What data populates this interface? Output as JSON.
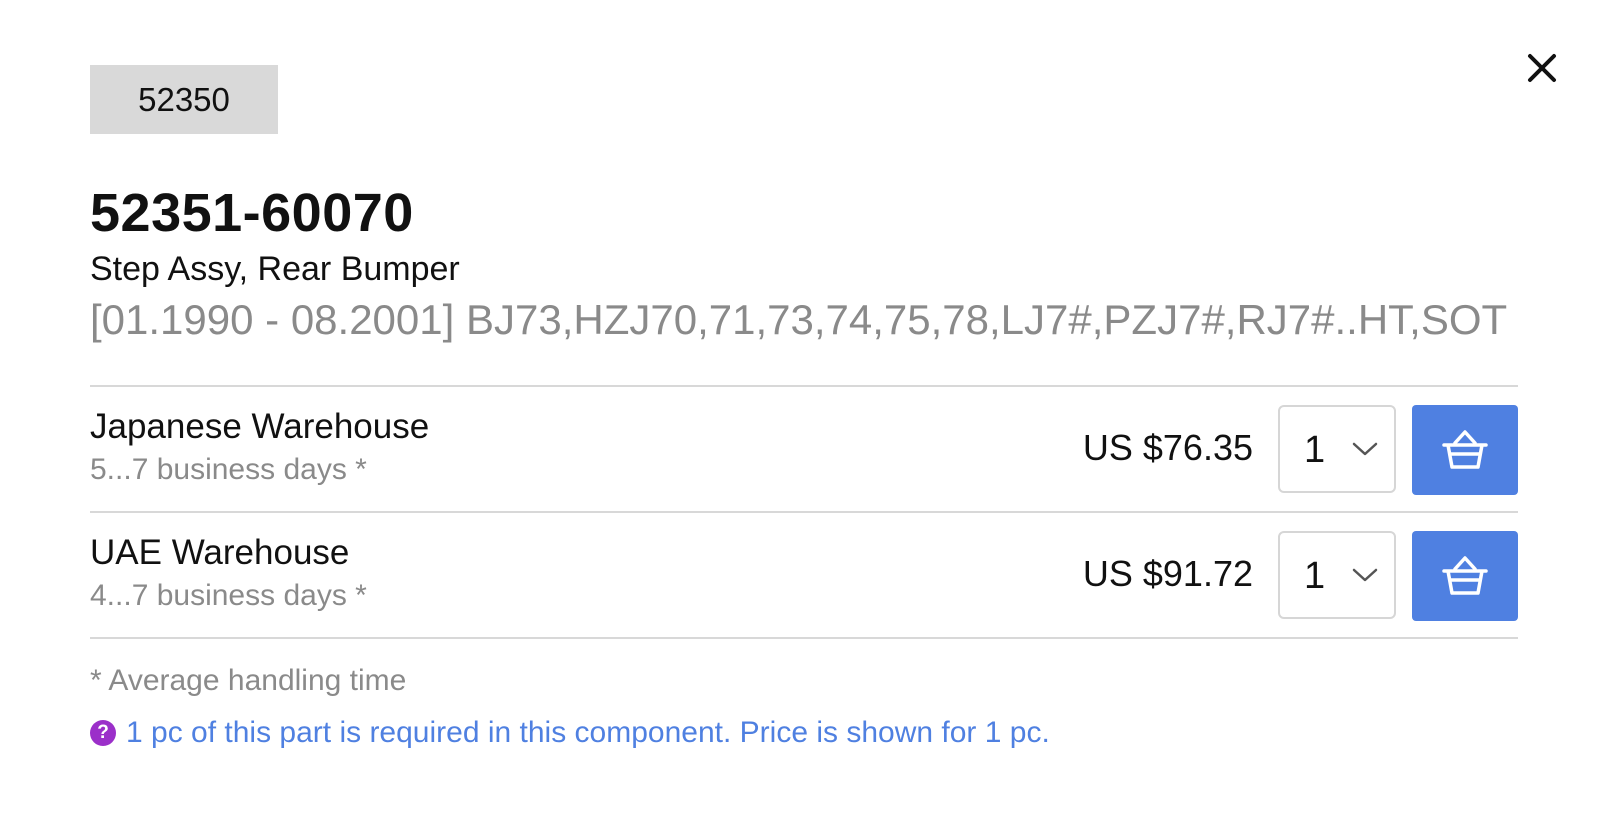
{
  "dialog": {
    "close_icon": "close-icon"
  },
  "group_tag": "52350",
  "part": {
    "number": "52351-60070",
    "name": "Step Assy, Rear Bumper",
    "applicability": "[01.1990 - 08.2001] BJ73,HZJ70,71,73,74,75,78,LJ7#,PZJ7#,RJ7#..HT,SOT"
  },
  "offers": [
    {
      "warehouse": "Japanese Warehouse",
      "delivery": "5...7 business days *",
      "price": "US $76.35",
      "quantity": "1",
      "cart_icon": "basket-icon"
    },
    {
      "warehouse": "UAE Warehouse",
      "delivery": "4...7 business days *",
      "price": "US $91.72",
      "quantity": "1",
      "cart_icon": "basket-icon"
    }
  ],
  "footnote": "* Average handling time",
  "info": {
    "icon": "question-circle-icon",
    "text": "1 pc of this part is required in this component. Price is shown for 1 pc."
  },
  "colors": {
    "accent": "#4f80e1",
    "tag_bg": "#d9d9d9",
    "muted_text": "#8a8a8a",
    "info_icon": "#9b2fc9"
  }
}
